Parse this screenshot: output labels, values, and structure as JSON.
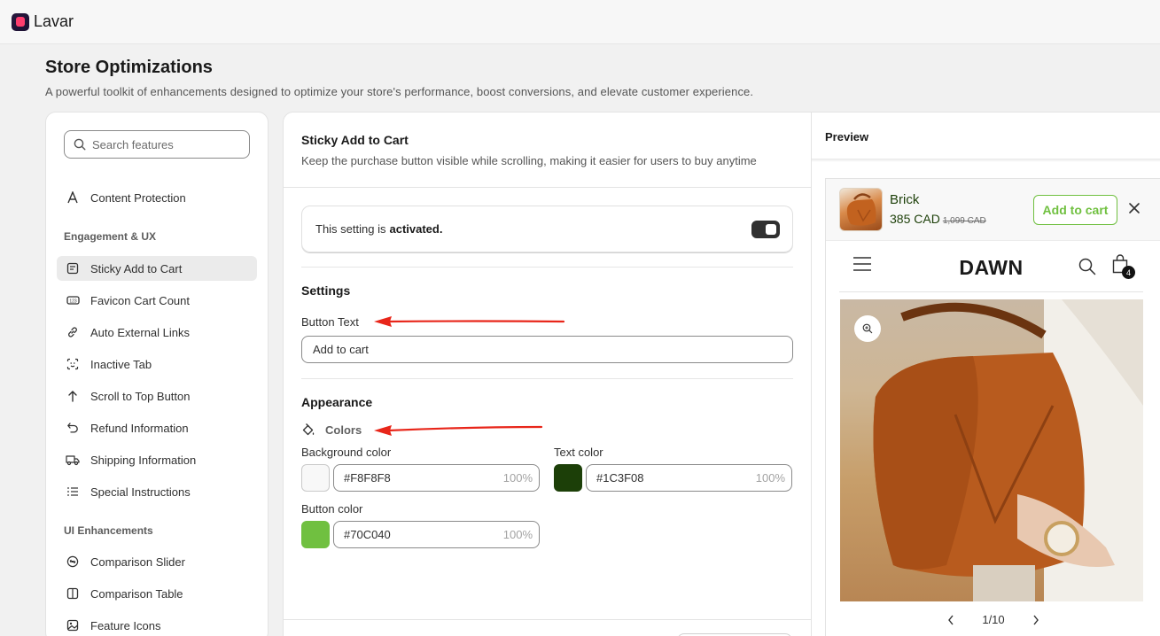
{
  "app": {
    "name": "Lavar"
  },
  "page": {
    "title": "Store Optimizations",
    "subtitle": "A powerful toolkit of enhancements designed to optimize your store's performance, boost conversions, and elevate customer experience."
  },
  "sidebar": {
    "search_placeholder": "Search features",
    "top_items": [
      {
        "label": "Content Protection",
        "icon": "letter-a-icon"
      }
    ],
    "sections": [
      {
        "label": "Engagement & UX",
        "items": [
          {
            "label": "Sticky Add to Cart",
            "icon": "sticky-note-icon",
            "active": true
          },
          {
            "label": "Favicon Cart Count",
            "icon": "counter-icon"
          },
          {
            "label": "Auto External Links",
            "icon": "link-icon"
          },
          {
            "label": "Inactive Tab",
            "icon": "face-scan-icon"
          },
          {
            "label": "Scroll to Top Button",
            "icon": "arrow-up-icon"
          },
          {
            "label": "Refund Information",
            "icon": "undo-icon"
          },
          {
            "label": "Shipping Information",
            "icon": "truck-icon"
          },
          {
            "label": "Special Instructions",
            "icon": "list-icon"
          }
        ]
      },
      {
        "label": "UI Enhancements",
        "items": [
          {
            "label": "Comparison Slider",
            "icon": "slider-icon"
          },
          {
            "label": "Comparison Table",
            "icon": "table-icon"
          },
          {
            "label": "Feature Icons",
            "icon": "image-icon"
          }
        ]
      }
    ]
  },
  "feature": {
    "title": "Sticky Add to Cart",
    "description": "Keep the purchase button visible while scrolling, making it easier for users to buy anytime",
    "status_prefix": "This setting is",
    "status_value": "activated.",
    "toggle_on": true,
    "settings_heading": "Settings",
    "button_text_label": "Button Text",
    "button_text_value": "Add to cart",
    "appearance_heading": "Appearance",
    "colors_label": "Colors",
    "bg_color_label": "Background color",
    "bg_color_value": "#F8F8F8",
    "bg_color_opacity": "100%",
    "text_color_label": "Text color",
    "text_color_value": "#1C3F08",
    "text_color_opacity": "100%",
    "button_color_label": "Button color",
    "button_color_value": "#70C040",
    "button_color_opacity": "100%"
  },
  "preview": {
    "label": "Preview",
    "product_name": "Brick",
    "price": "385 CAD",
    "old_price": "1,099 CAD",
    "add_button": "Add to cart",
    "store_brand": "DAWN",
    "cart_count": "4",
    "pager": "1/10"
  },
  "colors": {
    "accent_green": "#70C040",
    "text_green": "#1C3F08",
    "annotation_red": "#E8261A"
  }
}
